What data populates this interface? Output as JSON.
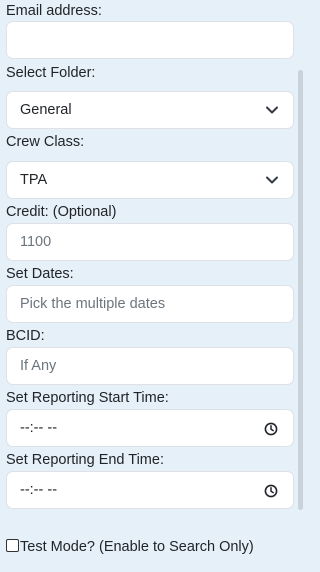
{
  "form": {
    "email": {
      "label": "Email address:",
      "value": ""
    },
    "folder": {
      "label": "Select Folder:",
      "selected": "General"
    },
    "crew_class": {
      "label": "Crew Class:",
      "selected": "TPA"
    },
    "credit": {
      "label": "Credit: (Optional)",
      "value": "1100"
    },
    "set_dates": {
      "label": "Set Dates:",
      "placeholder": "Pick the multiple dates"
    },
    "bcid": {
      "label": "BCID:",
      "placeholder": "If Any"
    },
    "reporting_start": {
      "label": "Set Reporting Start Time:",
      "value": "--:-- --"
    },
    "reporting_end": {
      "label": "Set Reporting End Time:",
      "value": "--:-- --"
    },
    "test_mode": {
      "label": "Test Mode? (Enable to Search Only)",
      "checked": false
    }
  },
  "icons": {
    "select_arrow": "chevron-down-icon",
    "time_picker": "clock-icon"
  }
}
